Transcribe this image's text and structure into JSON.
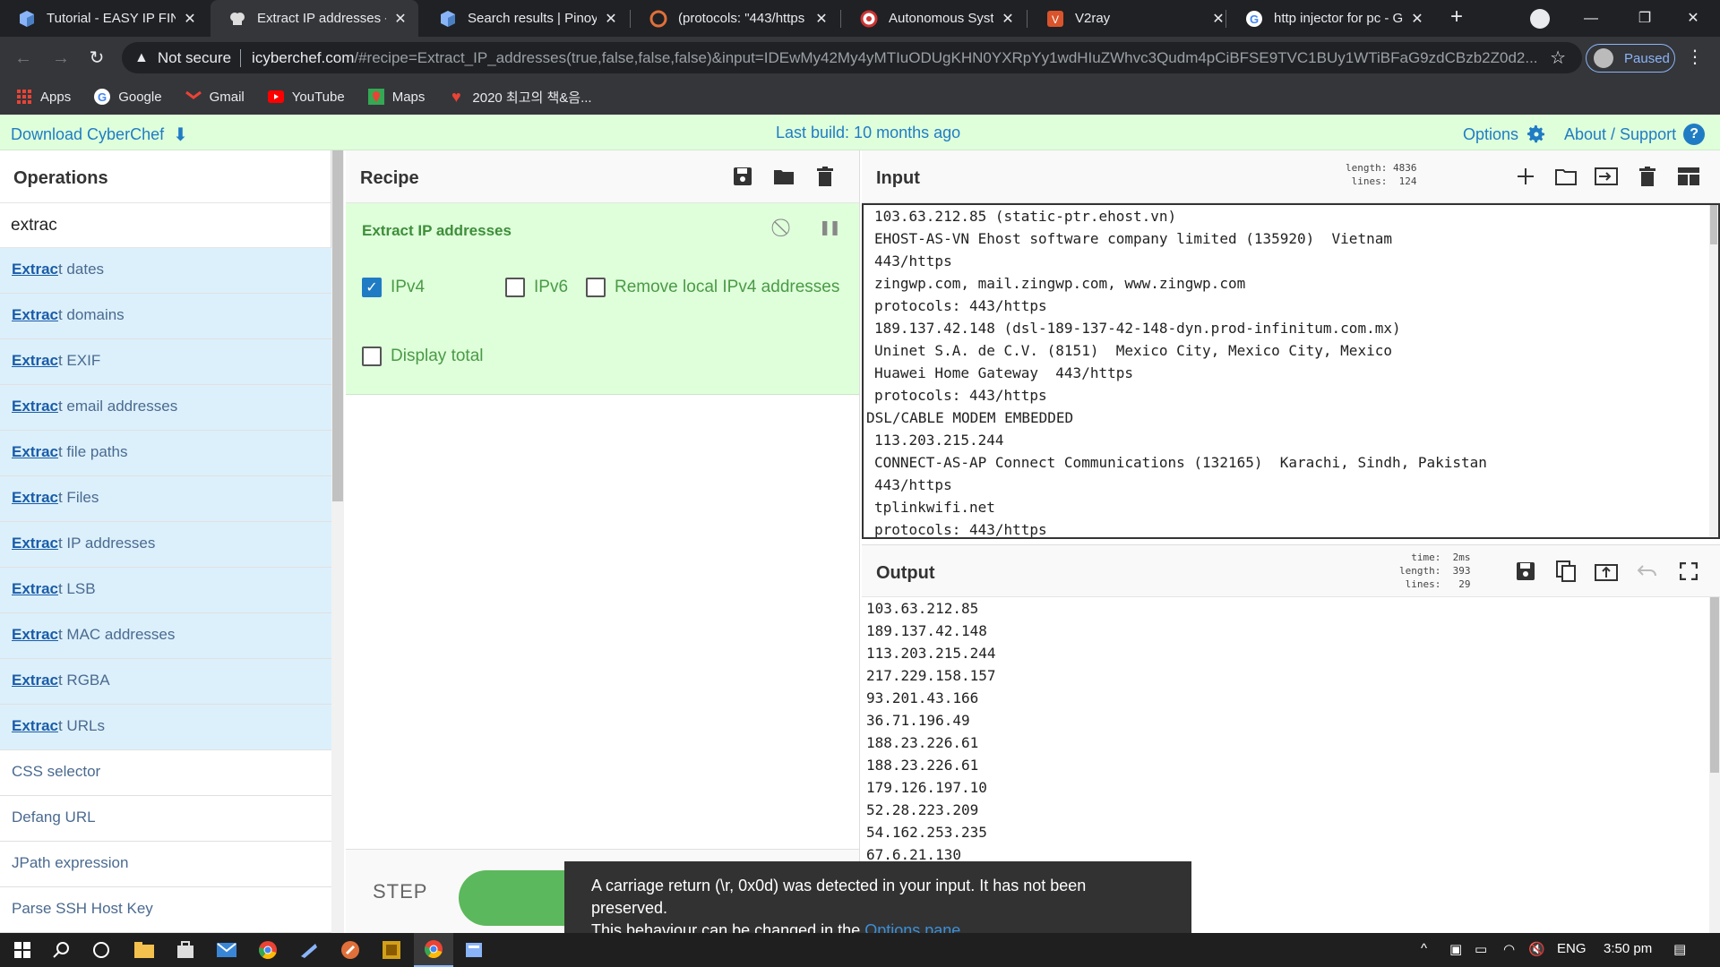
{
  "browser": {
    "tabs": [
      {
        "title": "Tutorial - EASY IP FINDER",
        "icon": "cube-icon"
      },
      {
        "title": "Extract IP addresses - CyberChef",
        "icon": "chef-hat-icon",
        "active": true
      },
      {
        "title": "Search results | Pinoy",
        "icon": "cube-icon"
      },
      {
        "title": "(protocols: \"443/https",
        "icon": "shodan-icon"
      },
      {
        "title": "Autonomous System Lookup",
        "icon": "as-icon"
      },
      {
        "title": "V2ray",
        "icon": "v2ray-icon"
      },
      {
        "title": "http injector for pc - Google",
        "icon": "google-icon"
      }
    ],
    "not_secure": "Not secure",
    "url_domain": "icyberchef.com",
    "url_rest": "/#recipe=Extract_IP_addresses(true,false,false,false)&input=IDEwMy42My4yMTIuODUgKHN0YXRpYy1wdHIuZWhvc3Qudm4pCiBFSE9TVC1BUy1WTiBFaG9zdCBzb2Z0d2...",
    "profile_label": "Paused",
    "bookmarks": [
      {
        "label": "Apps"
      },
      {
        "label": "Google"
      },
      {
        "label": "Gmail"
      },
      {
        "label": "YouTube"
      },
      {
        "label": "Maps"
      },
      {
        "label": "2020 최고의 책&음..."
      }
    ]
  },
  "banner": {
    "download": "Download CyberChef",
    "last_build": "Last build: 10 months ago",
    "options": "Options",
    "about": "About / Support"
  },
  "operations": {
    "title": "Operations",
    "search_value": "extrac",
    "items": [
      {
        "hl": "Extrac",
        "rest": "t dates"
      },
      {
        "hl": "Extrac",
        "rest": "t domains"
      },
      {
        "hl": "Extrac",
        "rest": "t EXIF"
      },
      {
        "hl": "Extrac",
        "rest": "t email addresses"
      },
      {
        "hl": "Extrac",
        "rest": "t file paths"
      },
      {
        "hl": "Extrac",
        "rest": "t Files"
      },
      {
        "hl": "Extrac",
        "rest": "t IP addresses"
      },
      {
        "hl": "Extrac",
        "rest": "t LSB"
      },
      {
        "hl": "Extrac",
        "rest": "t MAC addresses"
      },
      {
        "hl": "Extrac",
        "rest": "t RGBA"
      },
      {
        "hl": "Extrac",
        "rest": "t URLs"
      },
      {
        "hl": "",
        "rest": "CSS selector"
      },
      {
        "hl": "",
        "rest": "Defang URL"
      },
      {
        "hl": "",
        "rest": "JPath expression"
      },
      {
        "hl": "",
        "rest": "Parse SSH Host Key"
      }
    ]
  },
  "recipe": {
    "title": "Recipe",
    "operation": {
      "name": "Extract IP addresses",
      "ipv4_label": "IPv4",
      "ipv4": true,
      "ipv6_label": "IPv6",
      "ipv6": false,
      "remove_local_label": "Remove local IPv4 addresses",
      "remove_local": false,
      "display_total_label": "Display total",
      "display_total": false
    },
    "step_label": "STEP"
  },
  "input": {
    "title": "Input",
    "stats": "length: 4836\n lines:  124",
    "lines": [
      "103.63.212.85 (static-ptr.ehost.vn)",
      "EHOST-AS-VN Ehost software company limited (135920)  Vietnam",
      "443/https",
      "zingwp.com, mail.zingwp.com, www.zingwp.com",
      "protocols: 443/https",
      "189.137.42.148 (dsl-189-137-42-148-dyn.prod-infinitum.com.mx)",
      "Uninet S.A. de C.V. (8151)  Mexico City, Mexico City, Mexico",
      "Huawei Home Gateway  443/https",
      "protocols: 443/https",
      "DSL/CABLE MODEM EMBEDDED",
      "113.203.215.244",
      "CONNECT-AS-AP Connect Communications (132165)  Karachi, Sindh, Pakistan",
      "443/https",
      "tplinkwifi.net",
      "protocols: 443/https"
    ]
  },
  "output": {
    "title": "Output",
    "stats": "  time:  2ms\nlength:  393\n lines:   29",
    "lines": [
      "103.63.212.85",
      "189.137.42.148",
      "113.203.215.244",
      "217.229.158.157",
      "93.201.43.166",
      "36.71.196.49",
      "188.23.226.61",
      "188.23.226.61",
      "179.126.197.10",
      "52.28.223.209",
      "54.162.253.235",
      "67.6.21.130"
    ]
  },
  "toast": {
    "line1": "A carriage return (\\r, 0x0d) was detected in your input. It has not been preserved.",
    "line2": "This behaviour can be changed in the ",
    "link": "Options pane"
  },
  "taskbar": {
    "lang": "ENG",
    "time": "3:50 pm"
  },
  "colors": {
    "accent": "#1f7cc4",
    "recipe_bg": "#dfffdb",
    "op_highlight_bg": "#dcf0fb",
    "bake_green": "#5cb85c"
  }
}
